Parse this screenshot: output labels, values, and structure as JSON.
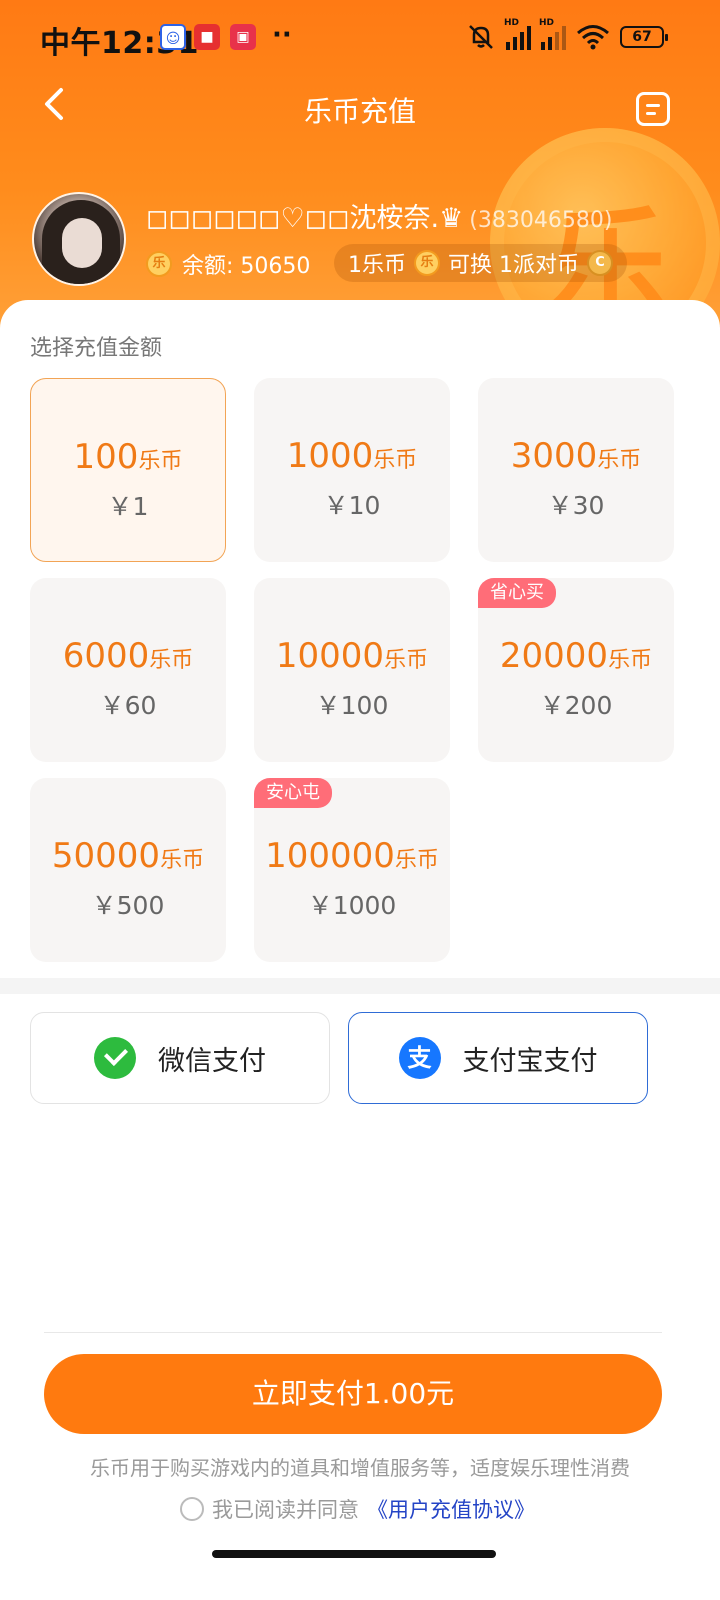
{
  "status_bar": {
    "time": "中午12:31",
    "dots": "··",
    "battery": "67",
    "notif_icons": [
      "baidu-app-icon",
      "shop-app-icon",
      "video-app-icon"
    ]
  },
  "nav": {
    "title": "乐币充值",
    "back_icon": "chevron-left-icon",
    "record_icon": "record-list-icon"
  },
  "profile": {
    "nickname": "◻◻◻◻◻◻♡◻◻沈桉奈.♛",
    "uid": "(383046580)",
    "coin_glyph": "乐",
    "balance_label": "余额:",
    "balance_value": "50650",
    "rate_left": "1乐币",
    "rate_right": "可换 1派对币"
  },
  "section_label": "选择充值金额",
  "packages": [
    {
      "coins": "100",
      "unit": "乐币",
      "price": "￥1",
      "tag": "",
      "selected": true
    },
    {
      "coins": "1000",
      "unit": "乐币",
      "price": "￥10",
      "tag": "",
      "selected": false
    },
    {
      "coins": "3000",
      "unit": "乐币",
      "price": "￥30",
      "tag": "",
      "selected": false
    },
    {
      "coins": "6000",
      "unit": "乐币",
      "price": "￥60",
      "tag": "",
      "selected": false
    },
    {
      "coins": "10000",
      "unit": "乐币",
      "price": "￥100",
      "tag": "",
      "selected": false
    },
    {
      "coins": "20000",
      "unit": "乐币",
      "price": "￥200",
      "tag": "省心买",
      "selected": false
    },
    {
      "coins": "50000",
      "unit": "乐币",
      "price": "￥500",
      "tag": "",
      "selected": false
    },
    {
      "coins": "100000",
      "unit": "乐币",
      "price": "￥1000",
      "tag": "安心屯",
      "selected": false
    }
  ],
  "payment": {
    "wechat_label": "微信支付",
    "alipay_label": "支付宝支付",
    "alipay_glyph": "支",
    "selected": "alipay"
  },
  "cta_label": "立即支付1.00元",
  "disclaimer": "乐币用于购买游戏内的道具和增值服务等，适度娱乐理性消费",
  "agreement": {
    "prefix": "我已阅读并同意",
    "link": "《用户充值协议》"
  },
  "colors": {
    "brand_orange": "#ff7a0f",
    "price_orange": "#f07a16",
    "tag_pink": "#ff6d78",
    "alipay_blue": "#1677ff",
    "wechat_green": "#2dbb3e"
  }
}
